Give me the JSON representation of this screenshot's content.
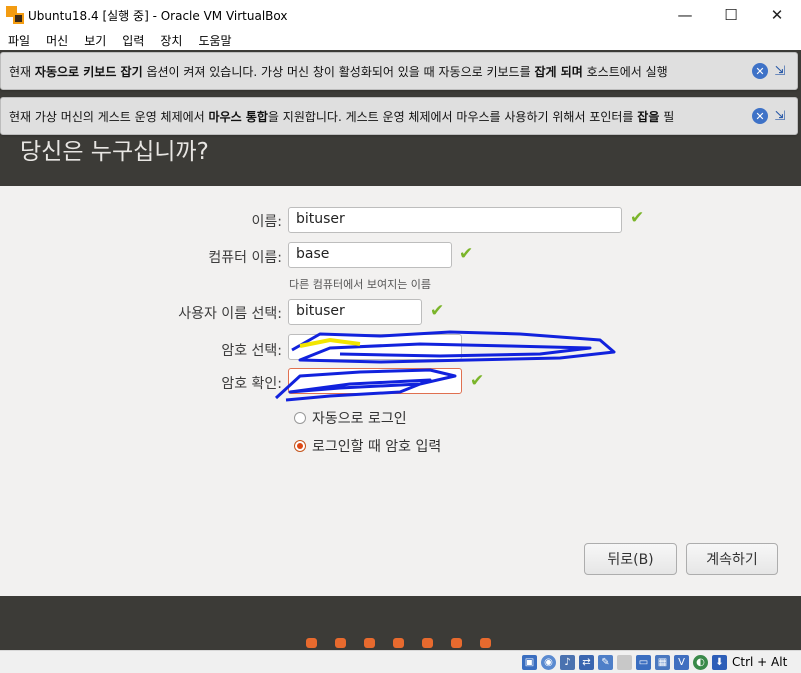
{
  "window": {
    "title": "Ubuntu18.4 [실행 중] - Oracle VM VirtualBox",
    "controls": {
      "minimize": "—",
      "maximize": "☐",
      "close": "✕"
    }
  },
  "menu": [
    "파일",
    "머신",
    "보기",
    "입력",
    "장치",
    "도움말"
  ],
  "notices": [
    {
      "pre": "현재 ",
      "b1": "자동으로 키보드 잡기",
      "mid": " 옵션이 켜져 있습니다. 가상 머신 창이 활성화되어 있을 때 자동으로 키보드를 ",
      "b2": "잡게 되며",
      "post": " 호스트에서 실행"
    },
    {
      "pre": "현재 가상 머신의 게스트 운영 체제에서 ",
      "b1": "마우스 통합",
      "mid": "을 지원합니다. 게스트 운영 체제에서 마우스를 사용하기 위해서 포인터를 ",
      "b2": "잡을",
      "post": " 필"
    }
  ],
  "installer": {
    "heading": "당신은 누구십니까?",
    "name_label": "이름:",
    "name_value": "bituser",
    "computer_label": "컴퓨터 이름:",
    "computer_value": "base",
    "computer_hint": "다른 컴퓨터에서 보여지는 이름",
    "username_label": "사용자 이름 선택:",
    "username_value": "bituser",
    "password_label": "암호 선택:",
    "confirm_label": "암호 확인:",
    "auto_login": "자동으로 로그인",
    "require_password": "로그인할 때 암호 입력",
    "back_button": "뒤로(B)",
    "continue_button": "계속하기",
    "check_mark": "✔"
  },
  "statusbar": {
    "host_key": "Ctrl + Alt"
  },
  "colors": {
    "ubuntu_orange": "#e86a2e",
    "header_dark": "#3c3b37",
    "check_green": "#7bb52a",
    "scribble_blue": "#1122dd"
  }
}
